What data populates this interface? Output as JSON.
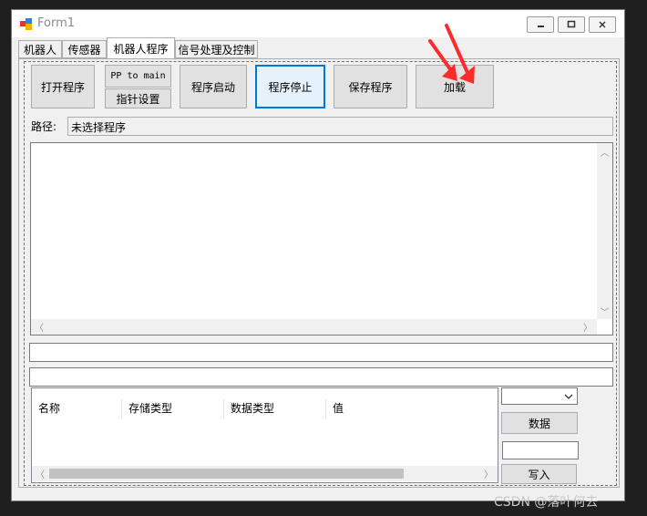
{
  "window": {
    "title": "Form1",
    "app_icon": "winforms-app-icon"
  },
  "caption_buttons": {
    "minimize": "minimize-icon",
    "maximize": "maximize-icon",
    "close": "close-icon"
  },
  "tabs": [
    {
      "label": "机器人",
      "active": false
    },
    {
      "label": "传感器",
      "active": false
    },
    {
      "label": "机器人程序",
      "active": true
    },
    {
      "label": "信号处理及控制",
      "active": false
    }
  ],
  "toolbar": {
    "open_program": "打开程序",
    "pp_to_main": "PP to main",
    "pointer_settings": "指针设置",
    "start_program": "程序启动",
    "stop_program": "程序停止",
    "save_program": "保存程序",
    "load": "加载"
  },
  "path": {
    "label": "路径:",
    "value": "未选择程序"
  },
  "program_text": "",
  "input1": "",
  "input2": "",
  "table": {
    "columns": [
      "名称",
      "存储类型",
      "数据类型",
      "值"
    ],
    "rows": []
  },
  "side": {
    "combo_value": "",
    "data_button": "数据",
    "write_value": "",
    "write_button": "写入"
  },
  "watermark": "CSDN @落叶何去",
  "colors": {
    "focus_border": "#0078d7",
    "annotation_arrow": "#ff2b2b"
  }
}
